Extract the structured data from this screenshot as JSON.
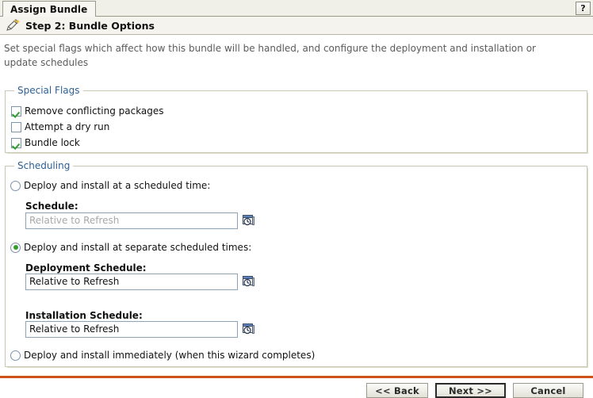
{
  "window": {
    "tab_label": "Assign Bundle",
    "help_label": "?",
    "help_icon": "question-mark-icon"
  },
  "step_header": {
    "icon": "magic-wand-icon",
    "title": "Step 2: Bundle Options"
  },
  "description": "Set special flags which affect how this bundle will be handled, and configure the deployment and installation or update schedules",
  "special_flags": {
    "legend": "Special Flags",
    "items": [
      {
        "label": "Remove conflicting packages",
        "checked": true
      },
      {
        "label": "Attempt a dry run",
        "checked": false
      },
      {
        "label": "Bundle lock",
        "checked": true
      }
    ]
  },
  "scheduling": {
    "legend": "Scheduling",
    "option_scheduled_time": {
      "label": "Deploy and install at a scheduled time:",
      "selected": false,
      "schedule": {
        "label": "Schedule:",
        "value": "Relative to Refresh",
        "disabled": true,
        "picker_icon": "calendar-clock-icon"
      }
    },
    "option_separate_times": {
      "label": "Deploy and install at separate scheduled times:",
      "selected": true,
      "deployment_schedule": {
        "label": "Deployment Schedule:",
        "value": "Relative to Refresh",
        "disabled": false,
        "picker_icon": "calendar-clock-icon"
      },
      "installation_schedule": {
        "label": "Installation Schedule:",
        "value": "Relative to Refresh",
        "disabled": false,
        "picker_icon": "calendar-clock-icon"
      }
    },
    "option_immediately": {
      "label": "Deploy and install immediately (when this wizard completes)",
      "selected": false
    }
  },
  "buttons": {
    "back": "<< Back",
    "next": "Next >>",
    "cancel": "Cancel"
  },
  "colors": {
    "accent_line": "#d0501a",
    "legend_text": "#2c5f96",
    "check_green": "#2f9e2f",
    "group_border": "#c9c8b4"
  }
}
